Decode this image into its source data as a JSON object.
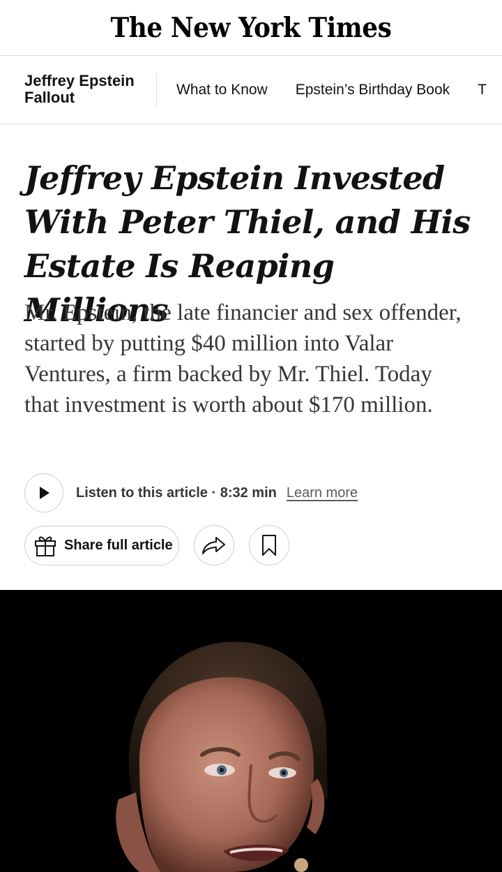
{
  "masthead": {
    "logo_text": "The New York Times"
  },
  "topic_bar": {
    "title": "Jeffrey Epstein Fallout",
    "links": [
      "What to Know",
      "Epstein’s Birthday Book",
      "T"
    ]
  },
  "article": {
    "headline": "Jeffrey Epstein Invested With Peter Thiel, and His Estate Is Reaping Millions",
    "summary": "Mr. Epstein, the late financier and sex offender, started by putting $40 million into Valar Ventures, a firm backed by Mr. Thiel. Today that investment is worth about $170 million."
  },
  "audio": {
    "listen_label": "Listen to this article · 8:32 min",
    "learn_more": "Learn more",
    "play_icon": "play-icon"
  },
  "actions": {
    "share_label": "Share full article",
    "gift_icon": "gift-icon",
    "forward_icon": "share-arrow-icon",
    "bookmark_icon": "bookmark-icon"
  },
  "colors": {
    "text": "#121212",
    "summary_text": "#363636",
    "border": "#dfdfdf",
    "photo_background": "#000000"
  }
}
